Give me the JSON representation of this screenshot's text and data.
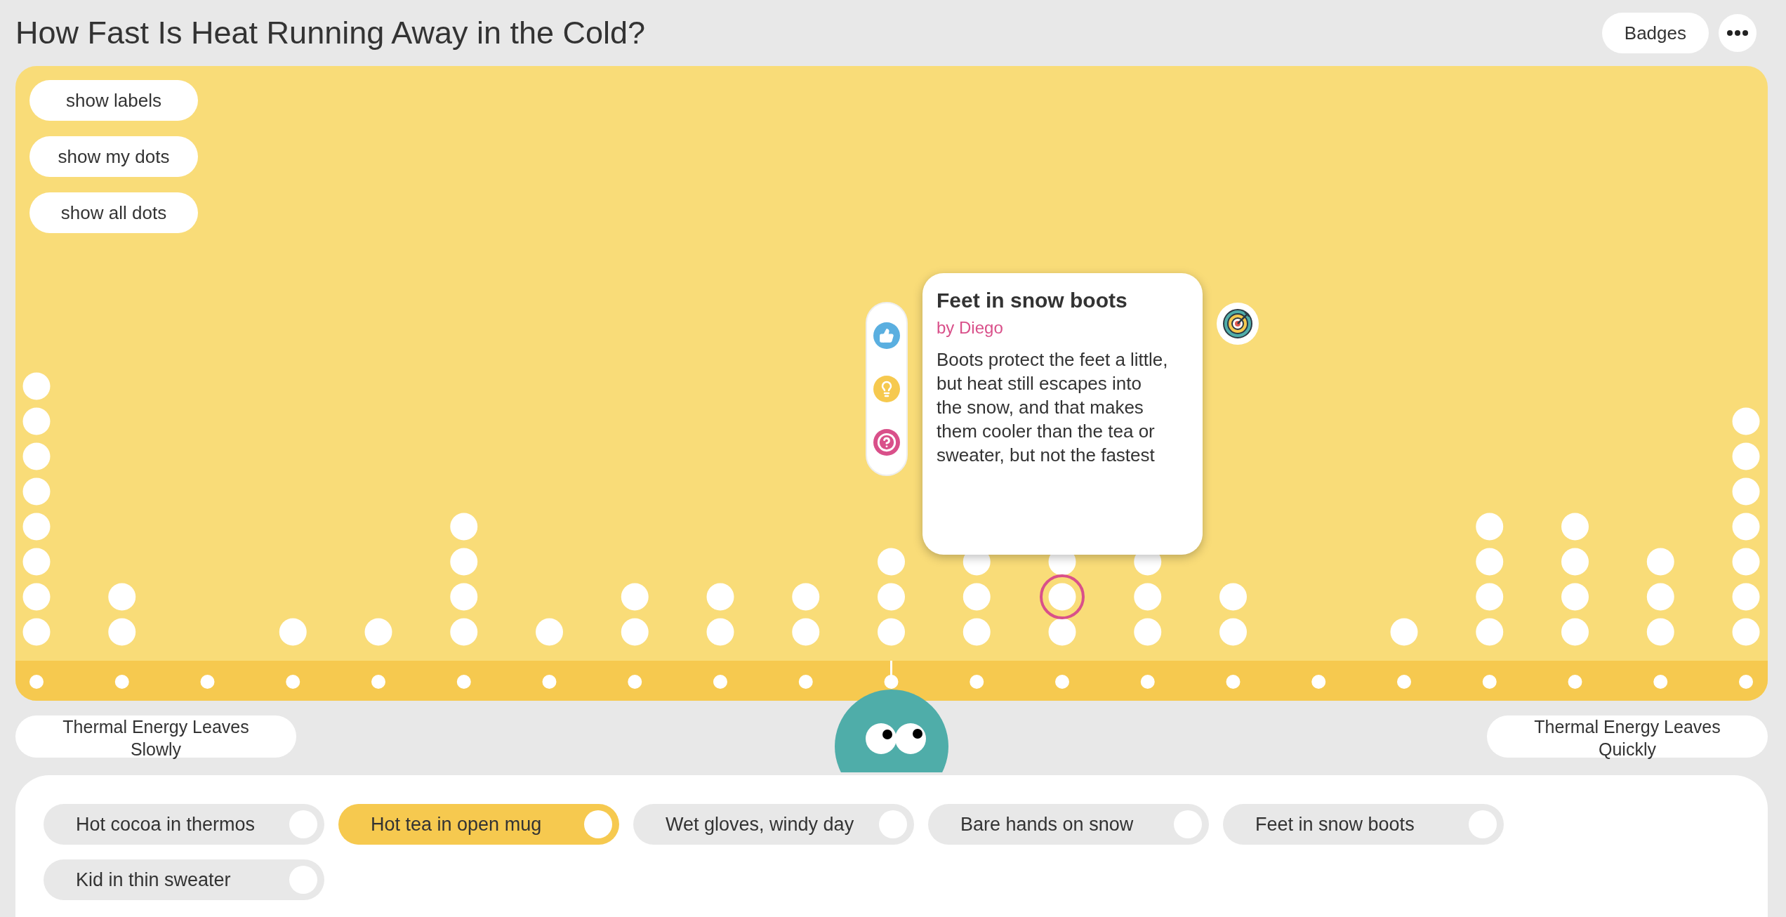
{
  "title": "How Fast Is Heat Running Away in the Cold?",
  "header_buttons": [
    {
      "label": "Badges"
    }
  ],
  "view_buttons": [
    {
      "label": "show labels"
    },
    {
      "label": "show my dots"
    },
    {
      "label": "show all dots"
    }
  ],
  "popup": {
    "title": "Feet in snow boots",
    "author": "by Diego",
    "text": "Boots protect the feet a little, but heat still escapes into the snow, and that makes them cooler than the tea or sweater, but not the fastest"
  },
  "axis": {
    "left_label": "Thermal Energy Leaves Slowly",
    "right_label": "Thermal Energy Leaves Quickly"
  },
  "cards": [
    {
      "label": "Hot cocoa in thermos",
      "selected": false
    },
    {
      "label": "Hot tea in open mug",
      "selected": true
    },
    {
      "label": "Wet gloves, windy day",
      "selected": false
    },
    {
      "label": "Bare hands on snow",
      "selected": false
    },
    {
      "label": "Feet in snow boots",
      "selected": false
    },
    {
      "label": "Kid in thin sweater",
      "selected": false
    }
  ]
}
